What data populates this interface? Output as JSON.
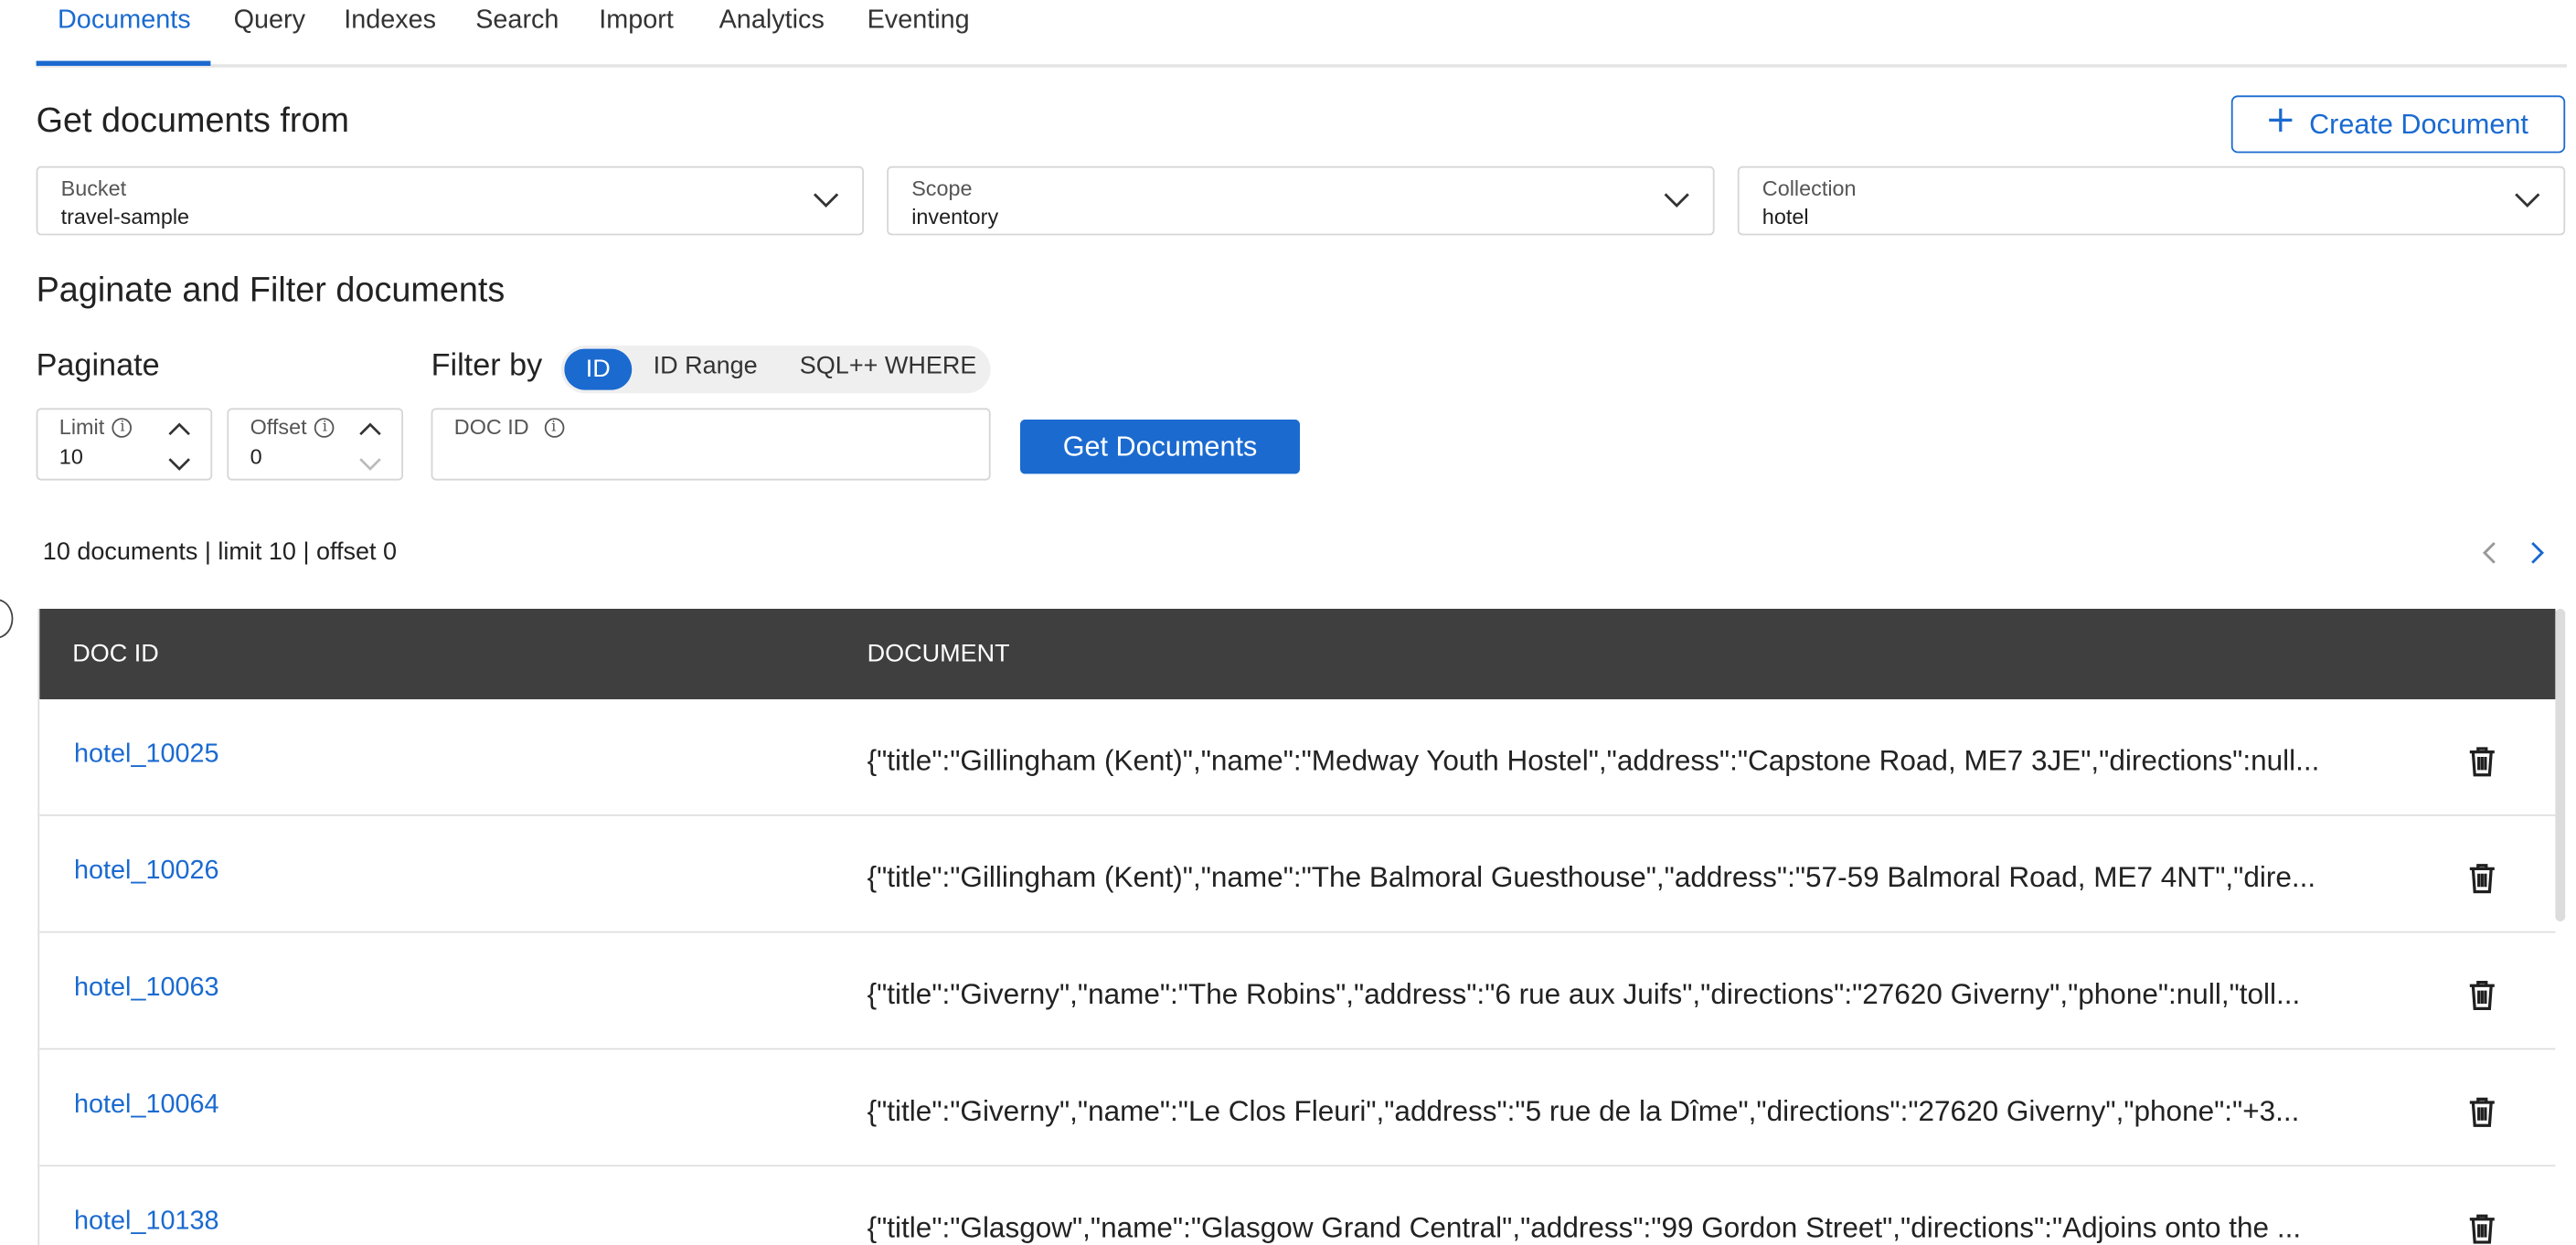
{
  "tabs": [
    {
      "label": "Documents",
      "active": true
    },
    {
      "label": "Query"
    },
    {
      "label": "Indexes"
    },
    {
      "label": "Search"
    },
    {
      "label": "Import"
    },
    {
      "label": "Analytics"
    },
    {
      "label": "Eventing"
    }
  ],
  "header": {
    "title": "Get documents from",
    "create_label": "Create Document"
  },
  "selects": {
    "bucket": {
      "label": "Bucket",
      "value": "travel-sample"
    },
    "scope": {
      "label": "Scope",
      "value": "inventory"
    },
    "collection": {
      "label": "Collection",
      "value": "hotel"
    }
  },
  "paginate_section": {
    "title": "Paginate and Filter documents",
    "paginate_label": "Paginate",
    "filter_label": "Filter by",
    "filter_options": [
      "ID",
      "ID Range",
      "SQL++ WHERE"
    ],
    "filter_selected": "ID"
  },
  "fields": {
    "limit": {
      "label": "Limit",
      "value": "10"
    },
    "offset": {
      "label": "Offset",
      "value": "0"
    },
    "doc_id": {
      "label": "DOC ID",
      "value": ""
    }
  },
  "get_label": "Get Documents",
  "summary": "10 documents | limit 10 | offset 0",
  "table": {
    "headers": [
      "DOC ID",
      "DOCUMENT"
    ],
    "rows": [
      {
        "id": "hotel_10025",
        "doc": "{\"title\":\"Gillingham (Kent)\",\"name\":\"Medway Youth Hostel\",\"address\":\"Capstone Road, ME7 3JE\",\"directions\":null..."
      },
      {
        "id": "hotel_10026",
        "doc": "{\"title\":\"Gillingham (Kent)\",\"name\":\"The Balmoral Guesthouse\",\"address\":\"57-59 Balmoral Road, ME7 4NT\",\"dire..."
      },
      {
        "id": "hotel_10063",
        "doc": "{\"title\":\"Giverny\",\"name\":\"The Robins\",\"address\":\"6 rue aux Juifs\",\"directions\":\"27620 Giverny\",\"phone\":null,\"toll..."
      },
      {
        "id": "hotel_10064",
        "doc": "{\"title\":\"Giverny\",\"name\":\"Le Clos Fleuri\",\"address\":\"5 rue de la Dîme\",\"directions\":\"27620 Giverny\",\"phone\":\"+3..."
      },
      {
        "id": "hotel_10138",
        "doc": "{\"title\":\"Glasgow\",\"name\":\"Glasgow Grand Central\",\"address\":\"99 Gordon Street\",\"directions\":\"Adjoins onto the ..."
      }
    ]
  },
  "colors": {
    "accent": "#1a6ad0",
    "table_header": "#3f3f3f"
  }
}
